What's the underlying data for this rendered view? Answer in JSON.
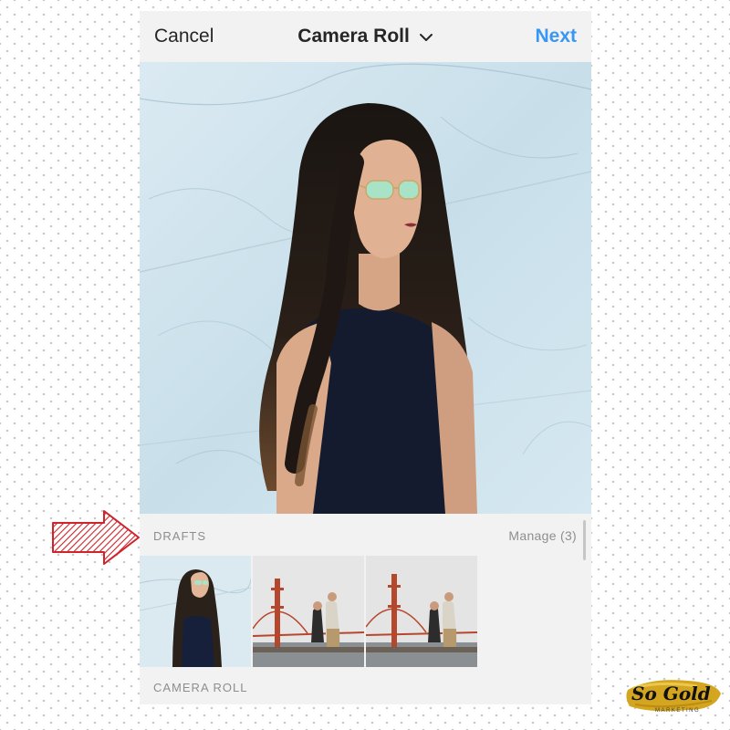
{
  "nav": {
    "cancel_label": "Cancel",
    "title": "Camera Roll",
    "title_icon": "chevron-down-icon",
    "next_label": "Next"
  },
  "drafts": {
    "label": "DRAFTS",
    "manage_label": "Manage (3)",
    "count": 3
  },
  "camera_roll": {
    "label": "CAMERA ROLL"
  },
  "branding": {
    "logo_text": "So Gold",
    "logo_sub": "MARKETING"
  },
  "colors": {
    "accent": "#3897f0",
    "arrow": "#d0232c",
    "logo_gold": "#d4a51f"
  }
}
